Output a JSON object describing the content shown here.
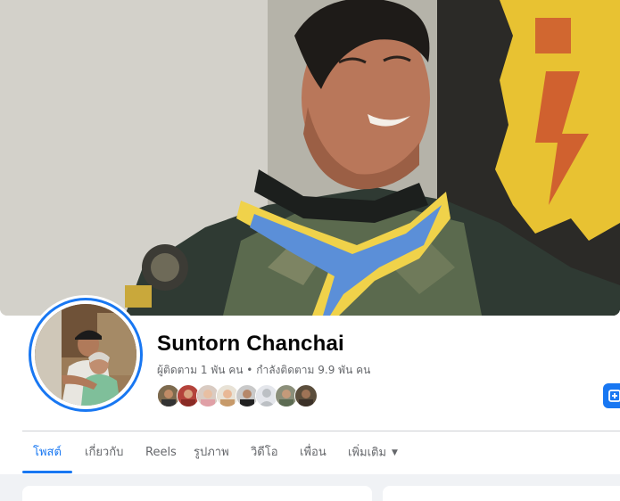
{
  "profile": {
    "name": "Suntorn Chanchai",
    "followers_text": "ผู้ติดตาม 1 พัน คน",
    "separator": " • ",
    "following_text": "กำลังติดตาม 9.9 พัน คน"
  },
  "tabs": [
    {
      "label": "โพสต์",
      "active": true
    },
    {
      "label": "เกี่ยวกับ",
      "active": false
    },
    {
      "label": "Reels",
      "active": false
    },
    {
      "label": "รูปภาพ",
      "active": false
    },
    {
      "label": "วิดีโอ",
      "active": false
    },
    {
      "label": "เพื่อน",
      "active": false
    },
    {
      "label": "เพิ่มเติม",
      "active": false,
      "dropdown": true
    }
  ],
  "friend_avatars": 8,
  "colors": {
    "accent": "#1877f2",
    "text_primary": "#050505",
    "text_secondary": "#65676b",
    "background": "#f0f2f5"
  }
}
